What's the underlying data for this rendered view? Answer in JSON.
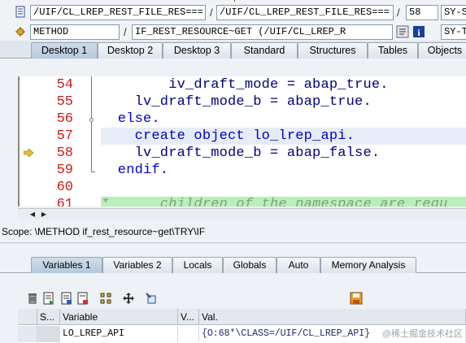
{
  "header": {
    "row1": {
      "program_field": "/UIF/CL_LREP_REST_FILE_RES===",
      "sep1": "/",
      "include_field": "/UIF/CL_LREP_REST_FILE_RES===",
      "sep2": "/",
      "line_field": "58",
      "sysfield": "SY-SUBRC"
    },
    "row2": {
      "event_type_field": "METHOD",
      "sep1": "/",
      "event_field": "IF_REST_RESOURCE~GET (/UIF/CL_LREP_R",
      "sysfield": "SY-TABIX"
    }
  },
  "desktop_tabs": [
    "Desktop 1",
    "Desktop 2",
    "Desktop 3",
    "Standard",
    "Structures",
    "Tables",
    "Objects"
  ],
  "editor": {
    "lines": [
      {
        "num": "54",
        "code": "        iv_draft_mode = abap_true."
      },
      {
        "num": "55",
        "code": "    lv_draft_mode_b = abap_true."
      },
      {
        "num": "56",
        "code": "  else."
      },
      {
        "num": "57",
        "code": "    create object lo_lrep_api."
      },
      {
        "num": "58",
        "code": "    lv_draft_mode_b = abap_false."
      },
      {
        "num": "59",
        "code": "  endif."
      },
      {
        "num": "60",
        "code": ""
      },
      {
        "num": "61",
        "code": "*      children of the namespace are requ"
      }
    ]
  },
  "scope": "Scope: \\METHOD if_rest_resource~get\\TRY\\IF",
  "variable_tabs": [
    "Variables 1",
    "Variables 2",
    "Locals",
    "Globals",
    "Auto",
    "Memory Analysis"
  ],
  "grid": {
    "headers": [
      "S...",
      "Variable",
      "V...",
      "Val."
    ],
    "row": {
      "variable": "LO_LREP_API",
      "value": "{O:68*\\CLASS=/UIF/CL_LREP_API}"
    }
  },
  "watermark": "@稀土掘金技术社区",
  "colors": {
    "line_number": "#d01818",
    "keyword": "#0000c8",
    "comment_bg": "#b8f0b8"
  },
  "icons": [
    "document-icon",
    "execute-icon",
    "info-icon",
    "delete-icon",
    "save-icon",
    "breakpoint-arrow-icon"
  ]
}
